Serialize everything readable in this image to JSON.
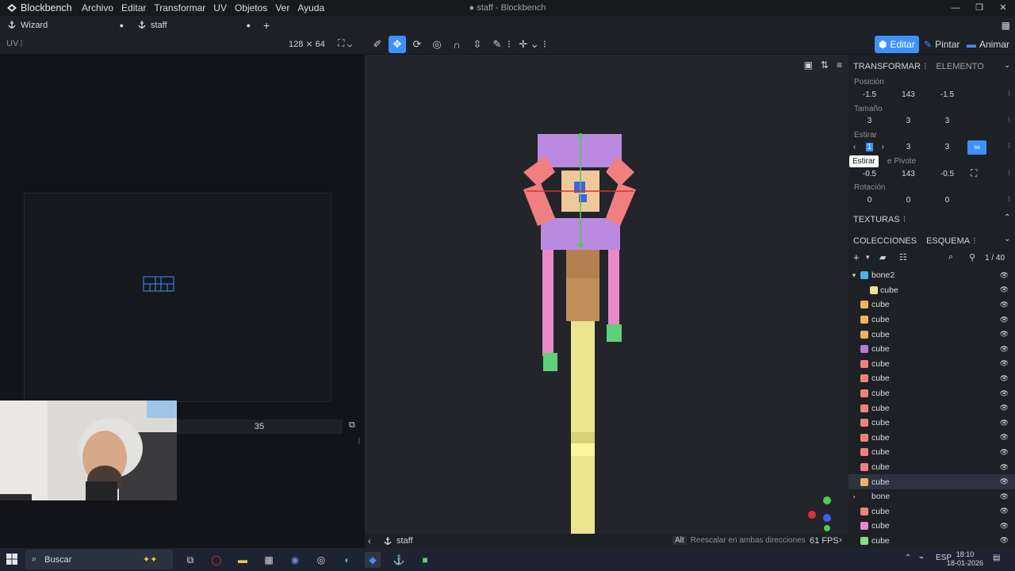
{
  "app": {
    "name": "Blockbench",
    "window_title": "● staff - Blockbench",
    "menu": [
      "Archivo",
      "Editar",
      "Transformar",
      "UV",
      "Objetos",
      "Ver",
      "Ayuda"
    ]
  },
  "tabs": [
    {
      "label": "Wizard",
      "modified": "●"
    },
    {
      "label": "staff",
      "modified": "●"
    }
  ],
  "toolbar": {
    "uv_label": "UV",
    "uv_dots": "⁝",
    "uv_size": "128 ⨯ 64",
    "modes": [
      "Editar",
      "Pintar",
      "Animar"
    ]
  },
  "uv_panel": {
    "slider_value": "35",
    "more": "⁝"
  },
  "viewport": {
    "project_name": "staff",
    "hint_key": "Alt",
    "hint_text": "Reescalar en ambas direcciones",
    "fps": "61 FPS"
  },
  "right_panel": {
    "tabs": {
      "transform": "TRANSFORMAR",
      "element": "ELEMENTO"
    },
    "position_label": "Posición",
    "position": [
      "-1.5",
      "143",
      "-1.5"
    ],
    "size_label": "Tamaño",
    "size": [
      "3",
      "3",
      "3"
    ],
    "stretch_label": "Estirar",
    "stretch": [
      "1",
      "3",
      "3"
    ],
    "pivot_label_suffix": "e Pivote",
    "pivot": [
      "-0.5",
      "143",
      "-0.5"
    ],
    "rotation_label": "Rotación",
    "rotation": [
      "0",
      "0",
      "0"
    ],
    "tooltip": "Estirar",
    "textures": "TEXTURAS",
    "collections": "COLECCIONES",
    "outliner": "ESQUEMA",
    "count": "1 / 40",
    "nodes": [
      {
        "label": "bone2",
        "type": "group",
        "expanded": true,
        "indent": 0,
        "color": "#49b3e8"
      },
      {
        "label": "cube",
        "type": "cube",
        "indent": 1,
        "color": "#f2e28a"
      },
      {
        "label": "cube",
        "type": "cube",
        "indent": 0,
        "color": "#f0b25e"
      },
      {
        "label": "cube",
        "type": "cube",
        "indent": 0,
        "color": "#f0b25e"
      },
      {
        "label": "cube",
        "type": "cube",
        "indent": 0,
        "color": "#f0b25e"
      },
      {
        "label": "cube",
        "type": "cube",
        "indent": 0,
        "color": "#b07ed6"
      },
      {
        "label": "cube",
        "type": "cube",
        "indent": 0,
        "color": "#f08080"
      },
      {
        "label": "cube",
        "type": "cube",
        "indent": 0,
        "color": "#f08080"
      },
      {
        "label": "cube",
        "type": "cube",
        "indent": 0,
        "color": "#f08080"
      },
      {
        "label": "cube",
        "type": "cube",
        "indent": 0,
        "color": "#f08080"
      },
      {
        "label": "cube",
        "type": "cube",
        "indent": 0,
        "color": "#f08080"
      },
      {
        "label": "cube",
        "type": "cube",
        "indent": 0,
        "color": "#f08080"
      },
      {
        "label": "cube",
        "type": "cube",
        "indent": 0,
        "color": "#f08080"
      },
      {
        "label": "cube",
        "type": "cube",
        "indent": 0,
        "color": "#f08080"
      },
      {
        "label": "cube",
        "type": "cube",
        "indent": 0,
        "color": "#f0b25e",
        "selected": true
      },
      {
        "label": "bone",
        "type": "group",
        "expanded": false,
        "indent": 0,
        "color": ""
      },
      {
        "label": "cube",
        "type": "cube",
        "indent": 0,
        "color": "#f08080"
      },
      {
        "label": "cube",
        "type": "cube",
        "indent": 0,
        "color": "#e88ad0"
      },
      {
        "label": "cube",
        "type": "cube",
        "indent": 0,
        "color": "#7ee08a"
      }
    ]
  },
  "taskbar": {
    "search_placeholder": "Buscar",
    "lang": "ESP",
    "time": "18:10",
    "date": "18-01-2026"
  },
  "colors": {
    "accent": "#3e90ff",
    "panel": "#1d2025",
    "viewport": "#23252a"
  }
}
